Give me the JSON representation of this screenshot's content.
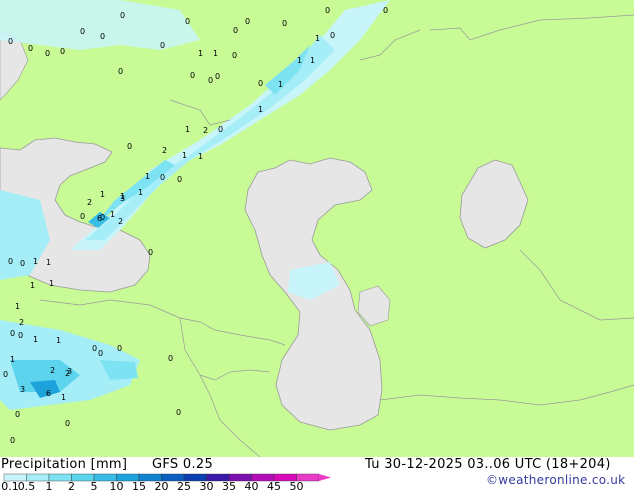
{
  "map": {
    "point_values": [
      "0",
      "0",
      "0",
      "0",
      "0",
      "0",
      "0",
      "0",
      "0",
      "0",
      "0",
      "0",
      "0",
      "0",
      "0",
      "0",
      "0",
      "0",
      "0",
      "0",
      "1",
      "1",
      "0",
      "0",
      "0",
      "1",
      "1",
      "1",
      "0",
      "1",
      "1",
      "1",
      "2",
      "0",
      "2",
      "1",
      "1",
      "1",
      "0",
      "0",
      "1",
      "1",
      "1",
      "2",
      "1",
      "3",
      "0",
      "6",
      "2",
      "1",
      "0",
      "1",
      "0",
      "1",
      "1",
      "1",
      "2",
      "0",
      "0",
      "0",
      "0",
      "1",
      "1",
      "0",
      "0",
      "0",
      "1",
      "2",
      "3",
      "2",
      "3",
      "6",
      "1",
      "0",
      "0",
      "0",
      "0"
    ]
  },
  "footer": {
    "title": "Precipitation [mm]",
    "model": "GFS 0.25",
    "datetime": "Tu 30-12-2025 03..06 UTC (18+204)",
    "credit": "©weatheronline.co.uk"
  },
  "legend": {
    "labels": [
      "0.1",
      "0.5",
      "1",
      "2",
      "5",
      "10",
      "15",
      "20",
      "25",
      "30",
      "35",
      "40",
      "45",
      "50"
    ],
    "colors": [
      "#c8f5fa",
      "#a5eef7",
      "#7de3f2",
      "#5cd4ee",
      "#38bde6",
      "#1ea2dc",
      "#1282cf",
      "#0a5fc0",
      "#0b3fb2",
      "#3a1aa8",
      "#7a10b0",
      "#b40cb8",
      "#d60ab8",
      "#e83cc8"
    ],
    "land_color": "#c8fa96",
    "sea_color": "#e6e6e6"
  }
}
